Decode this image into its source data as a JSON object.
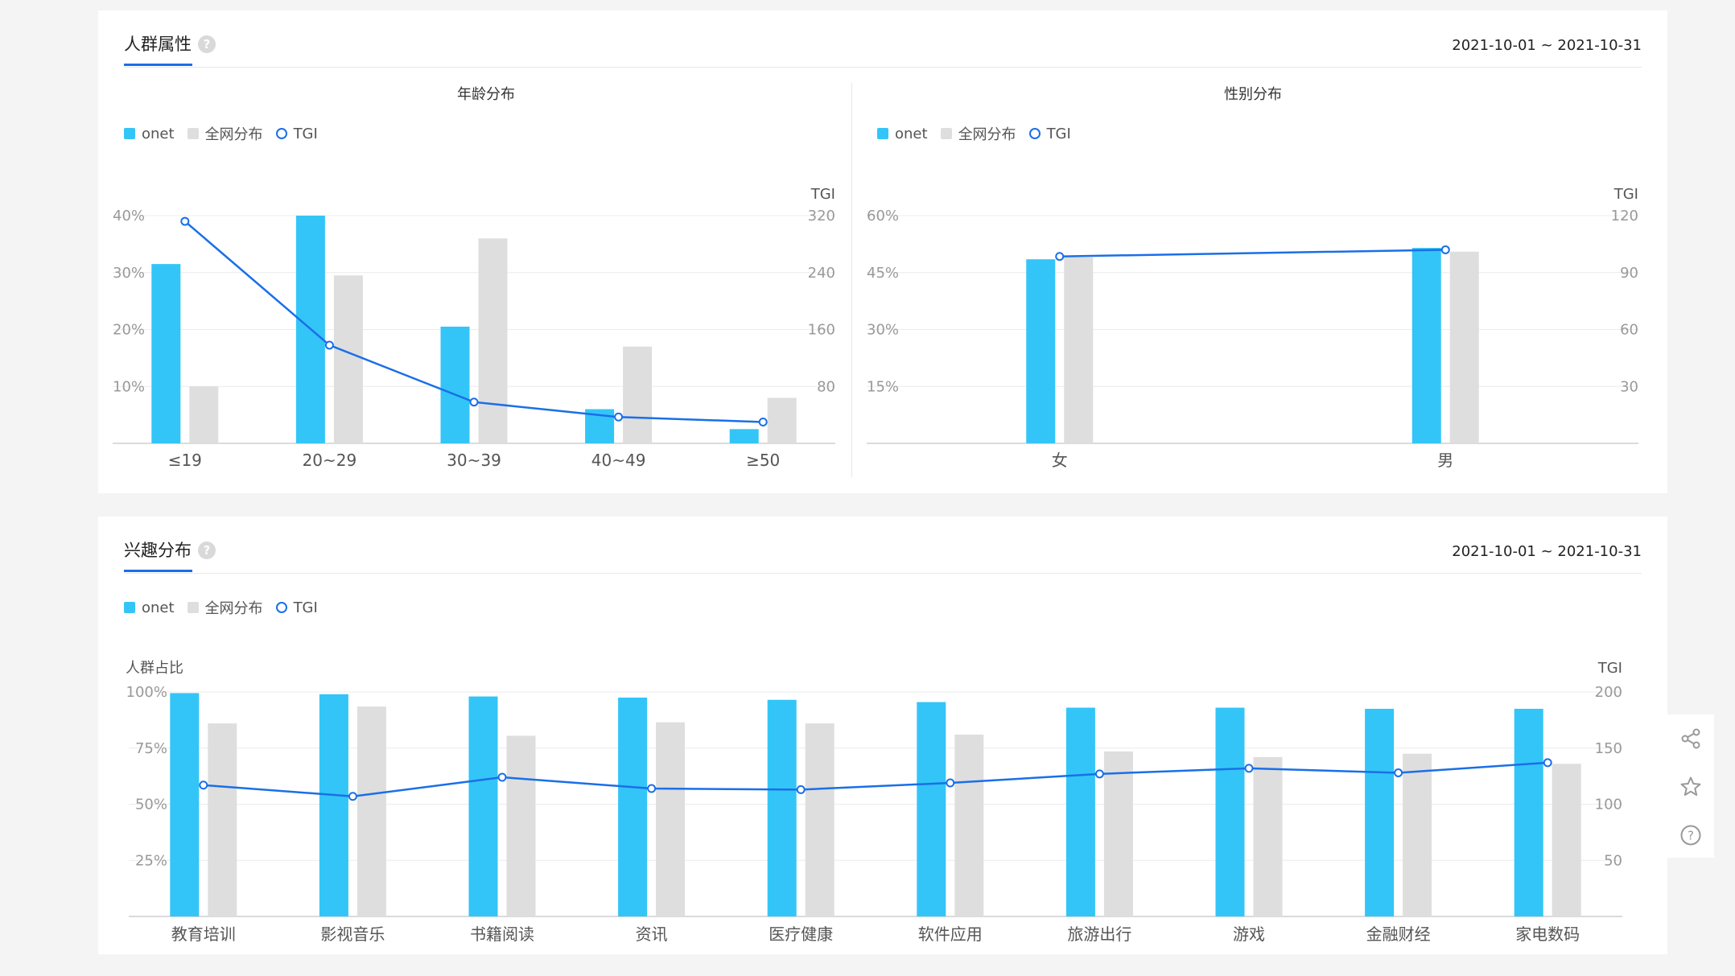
{
  "colors": {
    "primary": "#33c5f7",
    "secondary": "#dedede",
    "line": "#1a6fe8",
    "tab": "#1a6fe8"
  },
  "panel_attrs": {
    "title": "人群属性",
    "help_icon": "?",
    "date_range": "2021-10-01 ~ 2021-10-31"
  },
  "panel_interest": {
    "title": "兴趣分布",
    "help_icon": "?",
    "date_range": "2021-10-01 ~ 2021-10-31"
  },
  "legend": {
    "primary": "onet",
    "secondary": "全网分布",
    "line": "TGI"
  },
  "side_tools": {
    "icons": [
      "share-icon",
      "star-icon",
      "help-icon"
    ]
  },
  "chart_data": [
    {
      "id": "age",
      "type": "bar",
      "title": "年龄分布",
      "y_label_left": "",
      "y_label_right": "TGI",
      "categories": [
        "≤19",
        "20~29",
        "30~39",
        "40~49",
        "≥50"
      ],
      "ylim": [
        0,
        40
      ],
      "y_ticks": [
        10,
        20,
        30,
        40
      ],
      "y_tick_suffix": "%",
      "y2lim": [
        0,
        320
      ],
      "y2_ticks": [
        80,
        160,
        240,
        320
      ],
      "series": [
        {
          "name": "onet",
          "kind": "bar",
          "values": [
            31.5,
            40,
            20.5,
            6,
            2.5
          ]
        },
        {
          "name": "全网分布",
          "kind": "bar",
          "values": [
            10,
            29.5,
            36,
            17,
            8
          ]
        },
        {
          "name": "TGI",
          "kind": "line",
          "axis": "right",
          "values": [
            312,
            138,
            58,
            37,
            30
          ]
        }
      ]
    },
    {
      "id": "gender",
      "type": "bar",
      "title": "性别分布",
      "y_label_left": "",
      "y_label_right": "TGI",
      "categories": [
        "女",
        "男"
      ],
      "ylim": [
        0,
        60
      ],
      "y_ticks": [
        15,
        30,
        45,
        60
      ],
      "y_tick_suffix": "%",
      "y2lim": [
        0,
        120
      ],
      "y2_ticks": [
        30,
        60,
        90,
        120
      ],
      "series": [
        {
          "name": "onet",
          "kind": "bar",
          "values": [
            48.5,
            51.5
          ]
        },
        {
          "name": "全网分布",
          "kind": "bar",
          "values": [
            49,
            50.5
          ]
        },
        {
          "name": "TGI",
          "kind": "line",
          "axis": "right",
          "values": [
            98.5,
            102
          ]
        }
      ]
    },
    {
      "id": "interest",
      "type": "bar",
      "title": "",
      "y_label_left": "人群占比",
      "y_label_right": "TGI",
      "categories": [
        "教育培训",
        "影视音乐",
        "书籍阅读",
        "资讯",
        "医疗健康",
        "软件应用",
        "旅游出行",
        "游戏",
        "金融财经",
        "家电数码"
      ],
      "ylim": [
        0,
        100
      ],
      "y_ticks": [
        25,
        50,
        75,
        100
      ],
      "y_tick_suffix": "%",
      "y2lim": [
        0,
        200
      ],
      "y2_ticks": [
        50,
        100,
        150,
        200
      ],
      "series": [
        {
          "name": "onet",
          "kind": "bar",
          "values": [
            99.5,
            99,
            98,
            97.5,
            96.5,
            95.5,
            93,
            93,
            92.5,
            92.5
          ]
        },
        {
          "name": "全网分布",
          "kind": "bar",
          "values": [
            86,
            93.5,
            80.5,
            86.5,
            86,
            81,
            73.5,
            71,
            72.5,
            68
          ]
        },
        {
          "name": "TGI",
          "kind": "line",
          "axis": "right",
          "values": [
            117,
            107,
            124,
            114,
            113,
            119,
            127,
            132,
            128,
            137
          ]
        }
      ]
    }
  ]
}
